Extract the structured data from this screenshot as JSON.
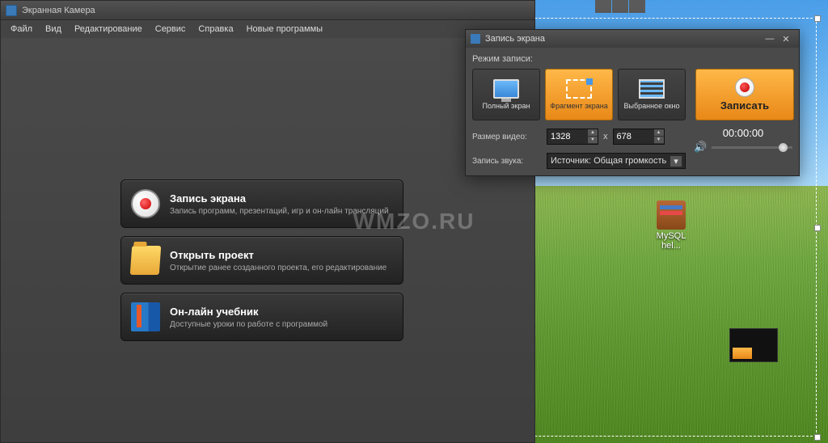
{
  "app": {
    "title": "Экранная Камера"
  },
  "menu": {
    "file": "Файл",
    "view": "Вид",
    "edit": "Редактирование",
    "service": "Сервис",
    "help": "Справка",
    "new_programs": "Новые программы"
  },
  "options": {
    "record": {
      "title": "Запись экрана",
      "sub": "Запись программ, презентаций, игр и он-лайн трансляций"
    },
    "open": {
      "title": "Открыть проект",
      "sub": "Открытие ранее созданного проекта, его редактирование"
    },
    "help": {
      "title": "Он-лайн учебник",
      "sub": "Доступные уроки по работе с программой"
    }
  },
  "watermark": "WMZO.RU",
  "dialog": {
    "title": "Запись экрана",
    "mode_label": "Режим записи:",
    "modes": {
      "full": "Полный экран",
      "fragment": "Фрагмент экрана",
      "window": "Выбранное окно"
    },
    "record_btn": "Записать",
    "size_label": "Размер видео:",
    "width": "1328",
    "x": "x",
    "height": "678",
    "audio_label": "Запись звука:",
    "audio_source": "Источник: Общая громкость",
    "timer": "00:00:00"
  },
  "desktop": {
    "icon1_label": "MySQL hel..."
  }
}
